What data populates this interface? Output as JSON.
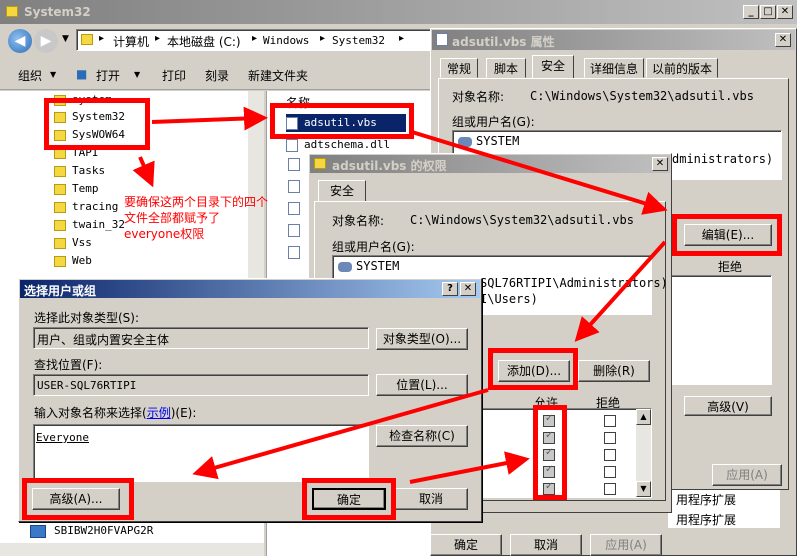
{
  "explorer": {
    "title": "System32",
    "breadcrumb": [
      "计算机",
      "本地磁盘 (C:)",
      "Windows",
      "System32"
    ],
    "toolbar": [
      "组织",
      "打开",
      "打印",
      "刻录",
      "新建文件夹"
    ],
    "tree": [
      "system",
      "System32",
      "SysWOW64",
      "TAPI",
      "Tasks",
      "Temp",
      "tracing",
      "twain_32",
      "Vss",
      "Web"
    ],
    "col_name": "名称",
    "files": [
      "adsutil.vbs",
      "adtschema.dll"
    ],
    "computer_item": "SBIBW2H0FVAPG2R"
  },
  "annotation": "要确保这两个目录下的四个文件全部都赋予了everyone权限",
  "props": {
    "title": "adsutil.vbs 属性",
    "tabs": [
      "常规",
      "脚本",
      "安全",
      "详细信息",
      "以前的版本"
    ],
    "object_label": "对象名称:",
    "object_value": "C:\\Windows\\System32\\adsutil.vbs",
    "group_label": "组或用户名(G):",
    "group_first": "SYSTEM",
    "administrators_tail": "dministrators)",
    "edit_button": "编辑(E)...",
    "allow_header": "拒绝",
    "advanced_button": "高级(V)",
    "apply_button": "应用(A)",
    "ok_button": "确定",
    "cancel_button": "取消",
    "apply_bottom": "应用(A)",
    "peek_items": [
      "用程序扩展",
      "用程序扩展"
    ]
  },
  "perms": {
    "title": "adsutil.vbs 的权限",
    "tab": "安全",
    "object_label": "对象名称:",
    "object_value": "C:\\Windows\\System32\\adsutil.vbs",
    "group_label": "组或用户名(G):",
    "users": [
      "SYSTEM",
      "SQL76RTIPI\\Administrators)",
      "I\\Users)"
    ],
    "add_button": "添加(D)...",
    "remove_button": "删除(R)",
    "allow_header": "允许",
    "deny_header": "拒绝",
    "allow_checked": [
      true,
      true,
      true,
      true,
      true
    ],
    "deny_checked": [
      false,
      false,
      false,
      false,
      false
    ]
  },
  "select_dialog": {
    "title": "选择用户或组",
    "type_label": "选择此对象类型(S):",
    "type_value": "用户、组或内置安全主体",
    "type_button": "对象类型(O)...",
    "location_label": "查找位置(F):",
    "location_value": "USER-SQL76RTIPI",
    "location_button": "位置(L)...",
    "enter_label_pre": "输入对象名称来选择(",
    "enter_label_link": "示例",
    "enter_label_post": ")(E):",
    "enter_value": "Everyone",
    "check_button": "检查名称(C)",
    "advanced_button": "高级(A)...",
    "ok_button": "确定",
    "cancel_button": "取消"
  },
  "colors": {
    "annotation_red": "#ff0000",
    "titlebar_active": "#0a246a"
  }
}
